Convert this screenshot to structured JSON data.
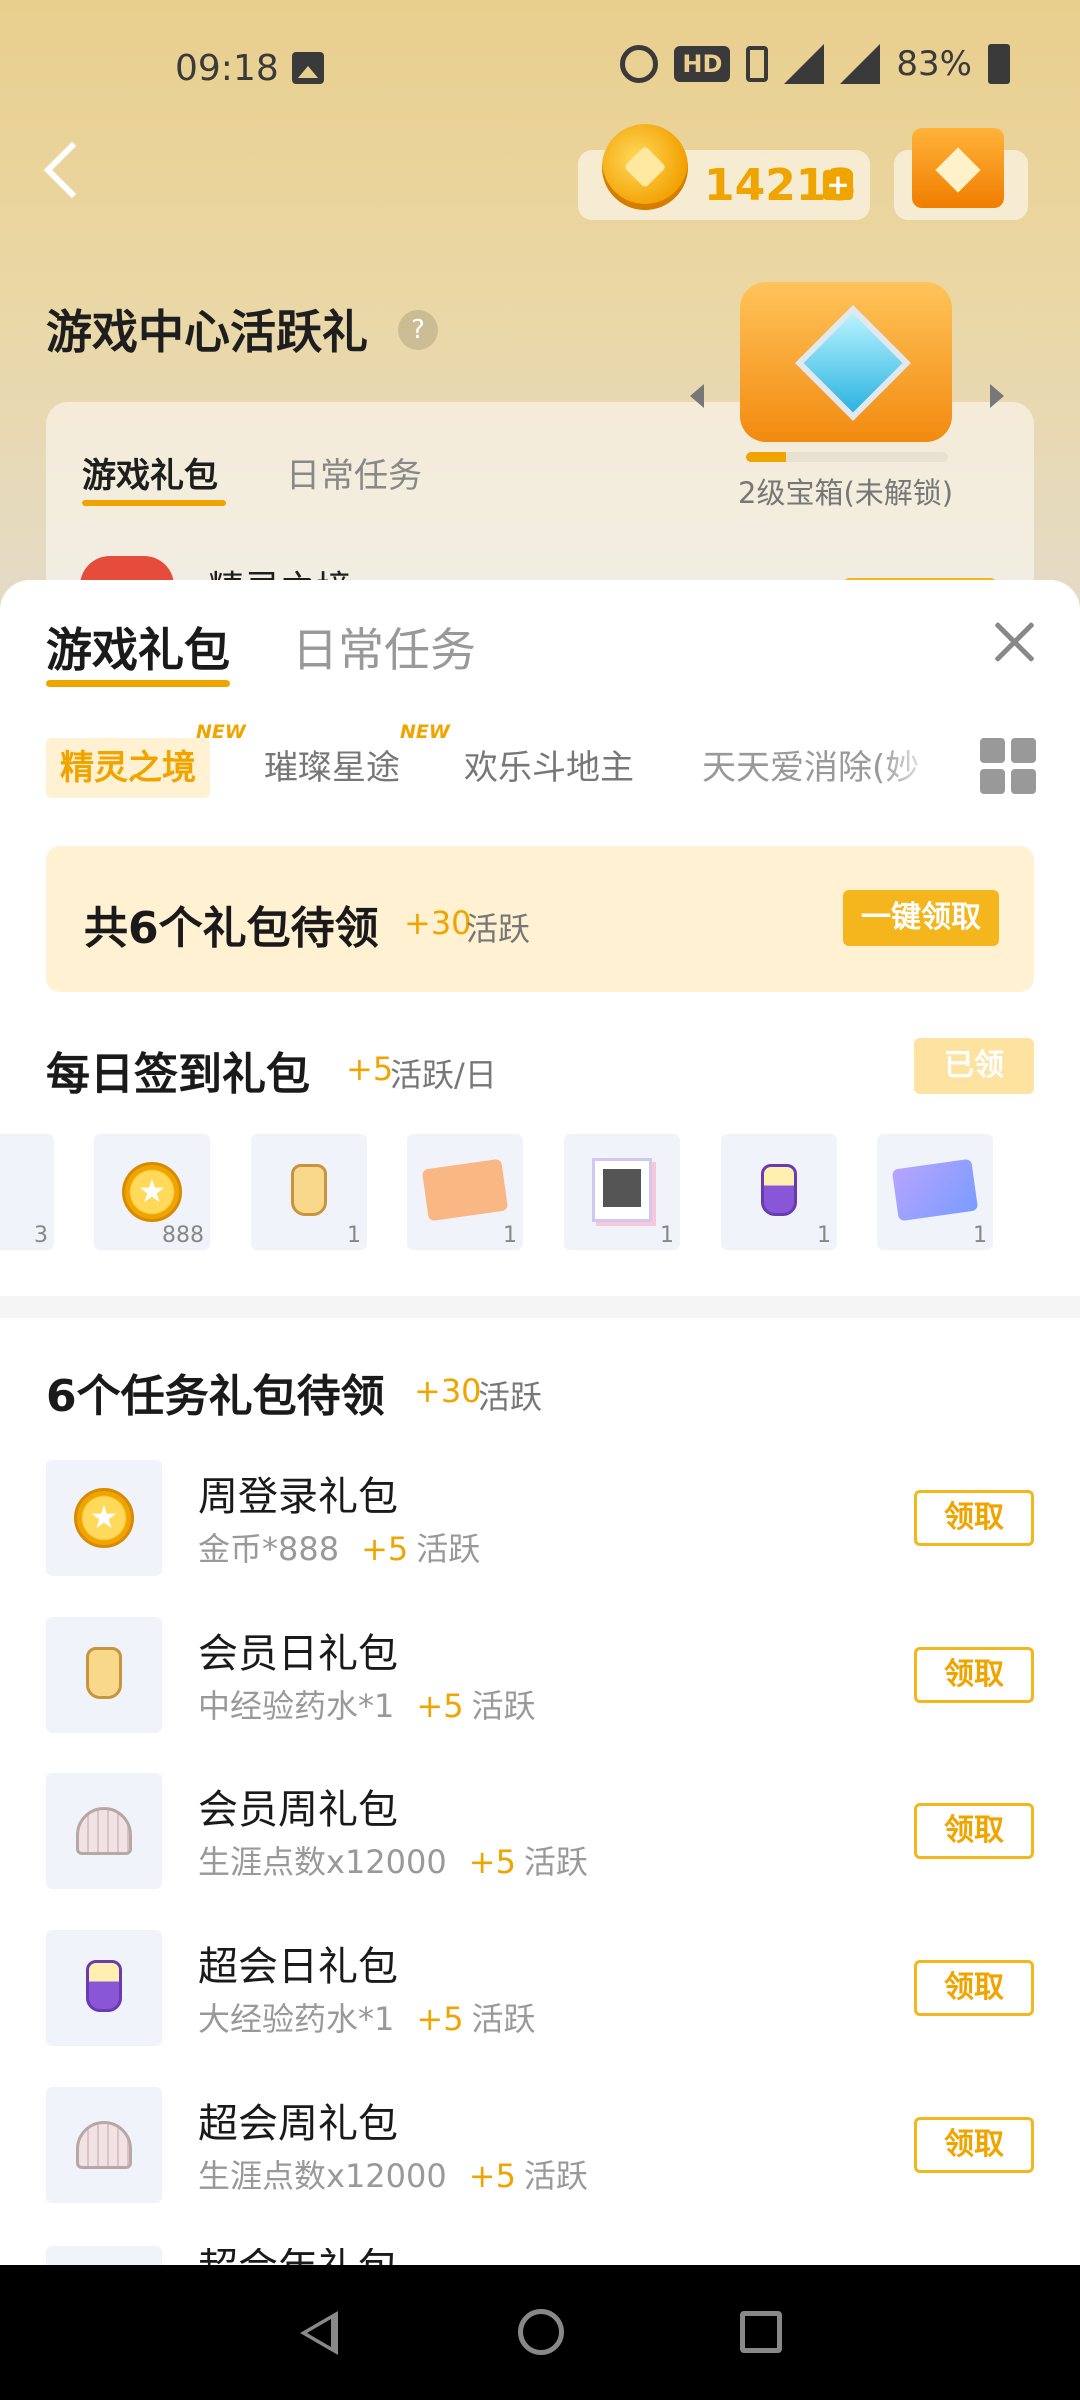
{
  "status_bar": {
    "time": "09:18",
    "hd_label": "HD",
    "network_1": "4G",
    "network_2": "4G",
    "battery": "83%"
  },
  "background_page": {
    "coins": "14213",
    "title": "游戏中心活跃礼",
    "help_symbol": "?",
    "tabs": [
      "游戏礼包",
      "日常任务"
    ],
    "chest_label": "2级宝箱(未解锁)",
    "chest_progress": 0.2,
    "game_name": "精灵之境"
  },
  "sheet": {
    "tabs": [
      "游戏礼包",
      "日常任务"
    ],
    "active_tab": 0,
    "game_tabs": [
      {
        "label": "精灵之境",
        "badge": "NEW",
        "active": true
      },
      {
        "label": "璀璨星途",
        "badge": "NEW",
        "active": false
      },
      {
        "label": "欢乐斗地主",
        "badge": "",
        "active": false
      },
      {
        "label": "天天爱消除(妙",
        "badge": "",
        "active": false
      }
    ],
    "claim_all": {
      "text": "共6个礼包待领",
      "plus": "+30",
      "unit": "活跃",
      "button": "一键领取"
    },
    "daily": {
      "title": "每日签到礼包",
      "plus": "+5",
      "unit": "活跃/日",
      "button": "已领",
      "rewards": [
        {
          "icon": "partial-reward-icon",
          "qty": "3"
        },
        {
          "icon": "gold-coin-icon",
          "qty": "888"
        },
        {
          "icon": "exp-potion-icon",
          "qty": "1"
        },
        {
          "icon": "ticket-icon",
          "qty": "1"
        },
        {
          "icon": "photo-frame-icon",
          "qty": "1"
        },
        {
          "icon": "purple-potion-icon",
          "qty": "1"
        },
        {
          "icon": "moon-ticket-icon",
          "qty": "1"
        }
      ]
    },
    "tasks": {
      "title": "6个任务礼包待领",
      "plus": "+30",
      "unit": "活跃",
      "items": [
        {
          "name": "周登录礼包",
          "reward": "金币*888",
          "plus": "+5",
          "unit": "活跃",
          "button": "领取",
          "icon": "gold-coin-icon"
        },
        {
          "name": "会员日礼包",
          "reward": "中经验药水*1",
          "plus": "+5",
          "unit": "活跃",
          "button": "领取",
          "icon": "exp-potion-icon"
        },
        {
          "name": "会员周礼包",
          "reward": "生涯点数x12000",
          "plus": "+5",
          "unit": "活跃",
          "button": "领取",
          "icon": "shell-icon"
        },
        {
          "name": "超会日礼包",
          "reward": "大经验药水*1",
          "plus": "+5",
          "unit": "活跃",
          "button": "领取",
          "icon": "purple-potion-icon"
        },
        {
          "name": "超会周礼包",
          "reward": "生涯点数x12000",
          "plus": "+5",
          "unit": "活跃",
          "button": "领取",
          "icon": "shell-icon"
        }
      ],
      "partial_item_name": "超会年礼包"
    }
  },
  "colors": {
    "accent": "#f0a400",
    "claim_card_bg": "#fff1d1",
    "button_fill": "#f5b51c"
  }
}
